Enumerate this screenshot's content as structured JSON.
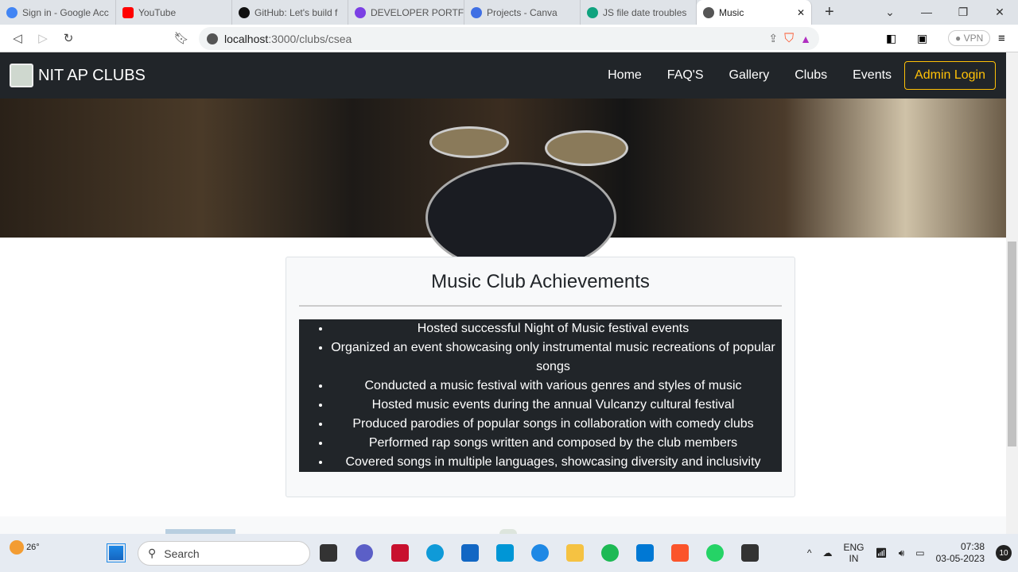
{
  "browser": {
    "tabs": [
      {
        "title": "Sign in - Google Acc",
        "color": "#4285f4"
      },
      {
        "title": "YouTube",
        "color": "#ff0000"
      },
      {
        "title": "GitHub: Let's build f",
        "color": "#111111"
      },
      {
        "title": "DEVELOPER PORTFO",
        "color": "#7b3fe4"
      },
      {
        "title": "Projects - Canva",
        "color": "#3f6fe4"
      },
      {
        "title": "JS file date troubles",
        "color": "#10a37f"
      },
      {
        "title": "Music",
        "color": "#555555"
      }
    ],
    "url_host": "localhost",
    "url_rest": ":3000/clubs/csea",
    "vpn_label": "VPN"
  },
  "navbar": {
    "brand": "NIT AP CLUBS",
    "links": [
      "Home",
      "FAQ'S",
      "Gallery",
      "Clubs",
      "Events"
    ],
    "admin_label": "Admin Login"
  },
  "achievements": {
    "title": "Music Club Achievements",
    "items": [
      "Hosted successful Night of Music festival events",
      "Organized an event showcasing only instrumental music recreations of popular songs",
      "Conducted a music festival with various genres and styles of music",
      "Hosted music events during the annual Vulcanzy cultural festival",
      "Produced parodies of popular songs in collaboration with comedy clubs",
      "Performed rap songs written and composed by the club members",
      "Covered songs in multiple languages, showcasing diversity and inclusivity"
    ]
  },
  "taskbar": {
    "weather": "26°",
    "search_placeholder": "Search",
    "lang1": "ENG",
    "lang2": "IN",
    "time": "07:38",
    "date": "03-05-2023",
    "notifications": "10"
  }
}
